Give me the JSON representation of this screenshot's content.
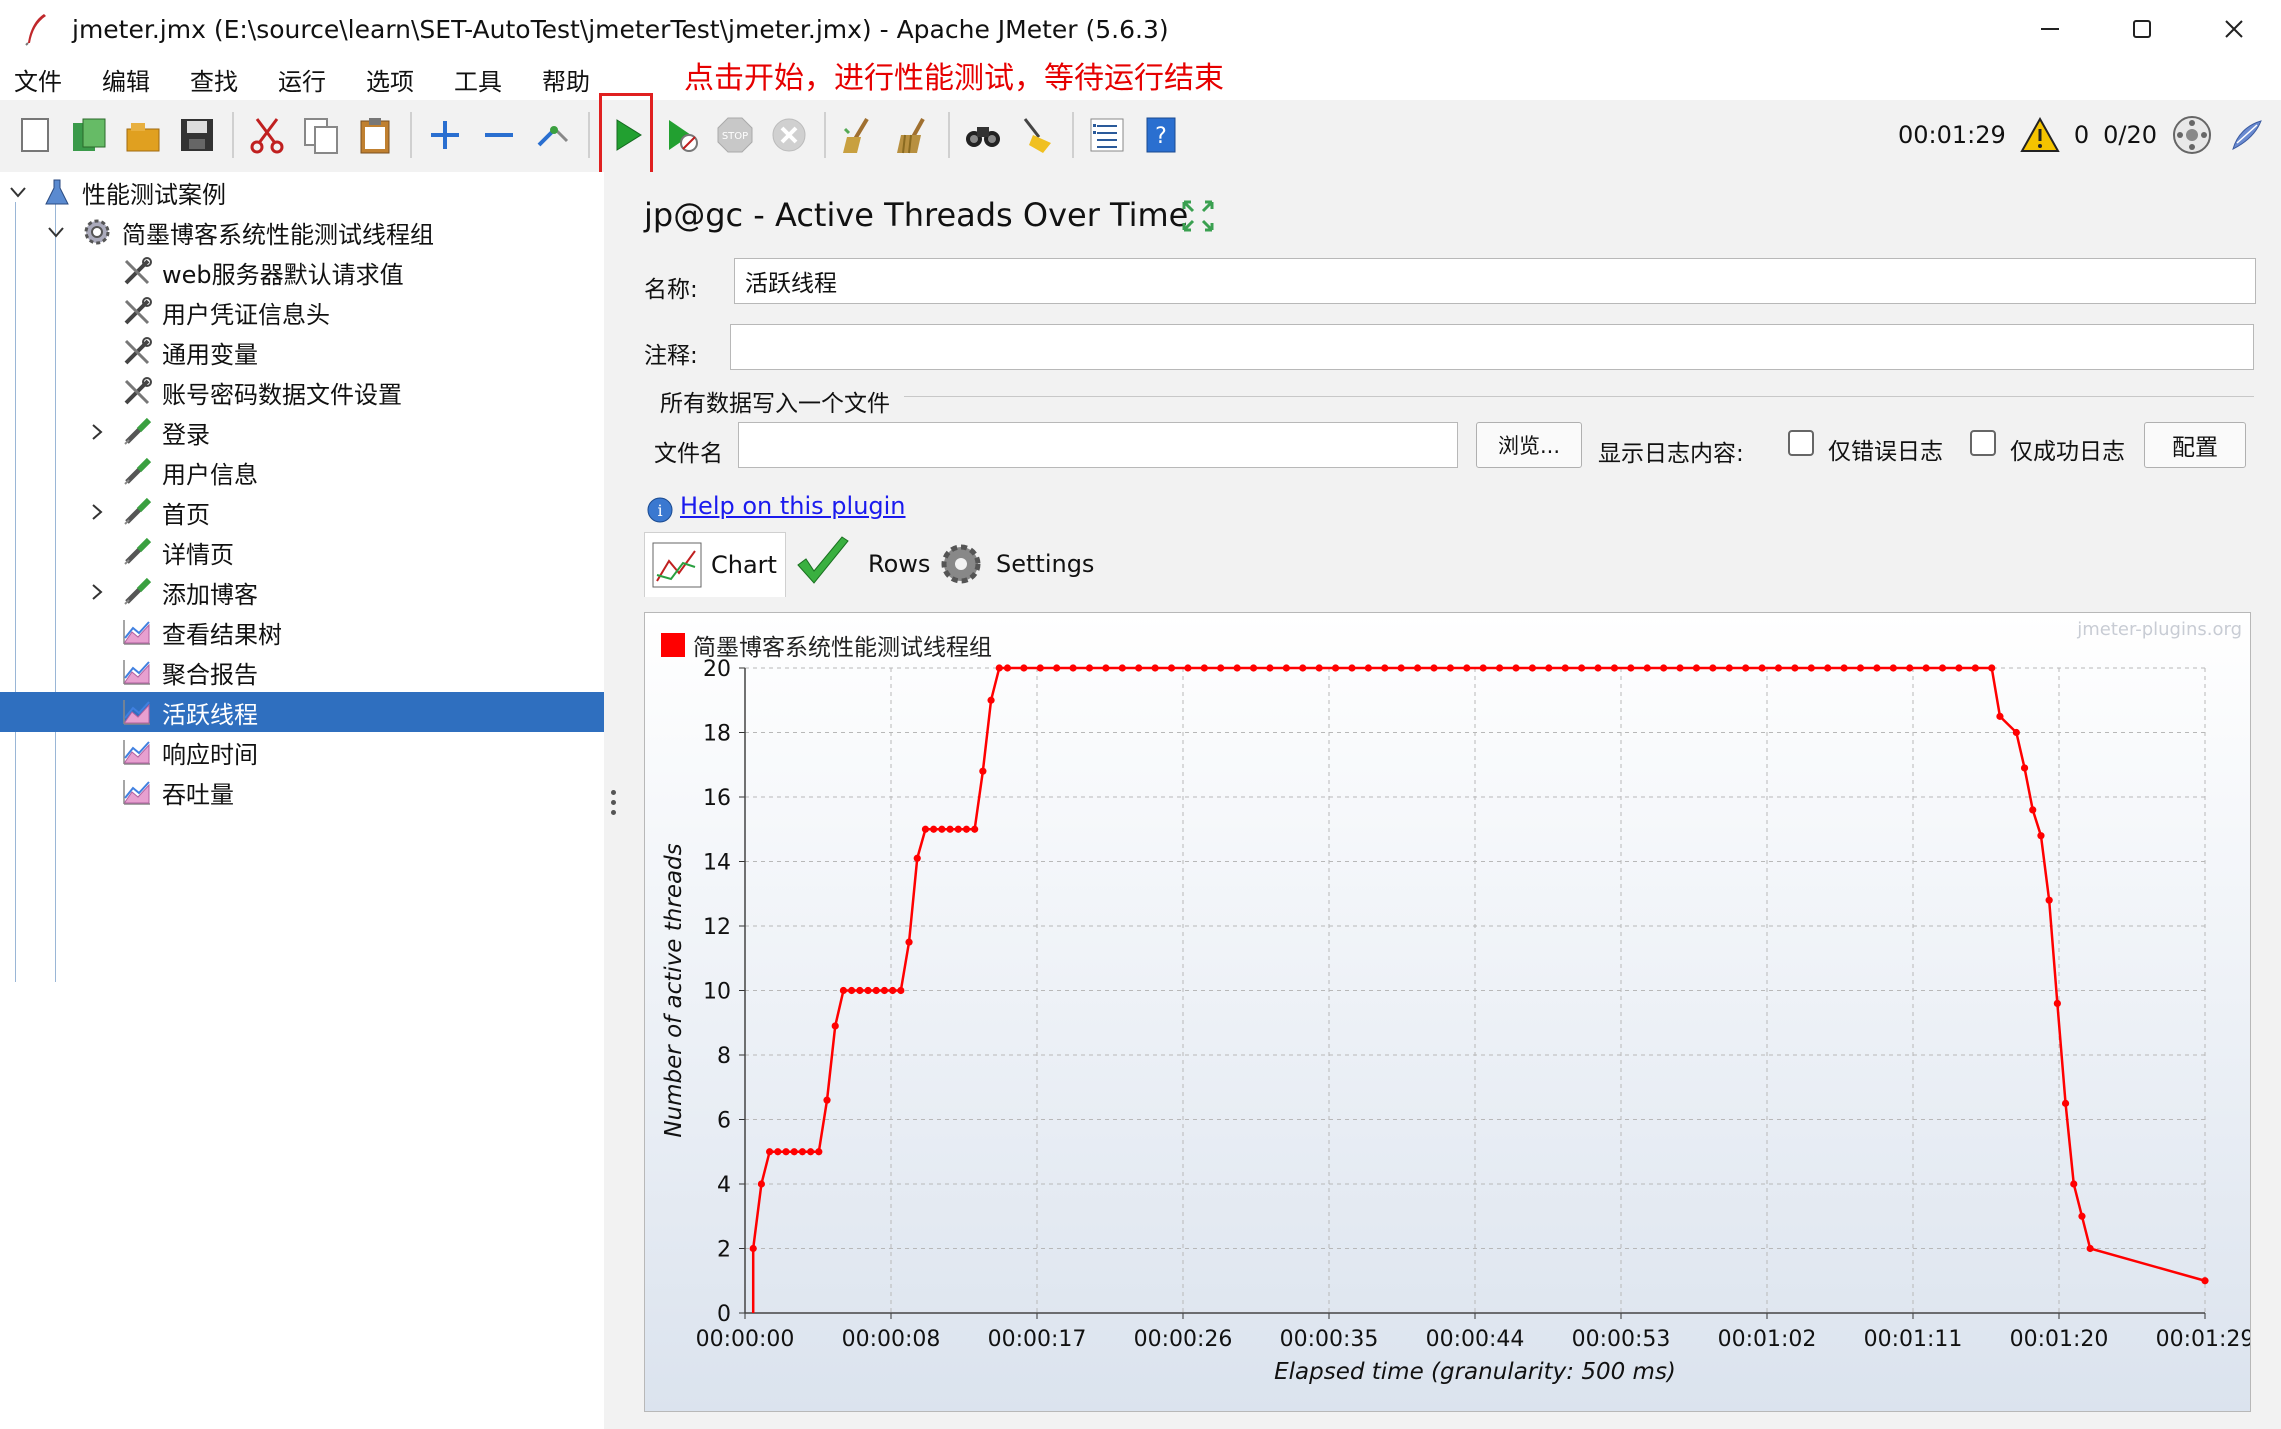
{
  "window": {
    "title": "jmeter.jmx (E:\\source\\learn\\SET-AutoTest\\jmeterTest\\jmeter.jmx) - Apache JMeter (5.6.3)",
    "minimize_icon": "minimize-icon",
    "maximize_icon": "maximize-icon",
    "close_icon": "close-icon"
  },
  "menu": [
    "文件",
    "编辑",
    "查找",
    "运行",
    "选项",
    "工具",
    "帮助"
  ],
  "annotation": "点击开始，进行性能测试，等待运行结束",
  "toolbar": {
    "elapsed": "00:01:29",
    "warnings": "0",
    "threads": "0/20",
    "icons": [
      "new-icon",
      "templates-icon",
      "open-icon",
      "save-icon",
      "cut-icon",
      "copy-icon",
      "paste-icon",
      "expand-icon",
      "collapse-icon",
      "toggle-icon",
      "start-icon",
      "start-no-pause-icon",
      "stop-icon",
      "shutdown-icon",
      "clear-icon",
      "clear-all-icon",
      "search-icon",
      "reset-search-icon",
      "function-helper-icon",
      "help-icon"
    ]
  },
  "tree": {
    "root": "性能测试案例",
    "thread_group": "简墨博客系统性能测试线程组",
    "items": [
      {
        "label": "web服务器默认请求值",
        "icon": "config-wrench-icon",
        "expandable": false
      },
      {
        "label": "用户凭证信息头",
        "icon": "config-wrench-icon",
        "expandable": false
      },
      {
        "label": "通用变量",
        "icon": "config-wrench-icon",
        "expandable": false
      },
      {
        "label": "账号密码数据文件设置",
        "icon": "config-wrench-icon",
        "expandable": false
      },
      {
        "label": "登录",
        "icon": "sampler-pipette-icon",
        "expandable": true
      },
      {
        "label": "用户信息",
        "icon": "sampler-pipette-icon",
        "expandable": false
      },
      {
        "label": "首页",
        "icon": "sampler-pipette-icon",
        "expandable": true
      },
      {
        "label": "详情页",
        "icon": "sampler-pipette-icon",
        "expandable": false
      },
      {
        "label": "添加博客",
        "icon": "sampler-pipette-icon",
        "expandable": true
      },
      {
        "label": "查看结果树",
        "icon": "listener-graph-icon",
        "expandable": false
      },
      {
        "label": "聚合报告",
        "icon": "listener-graph-icon",
        "expandable": false
      },
      {
        "label": "活跃线程",
        "icon": "listener-graph-icon",
        "expandable": false,
        "selected": true
      },
      {
        "label": "响应时间",
        "icon": "listener-graph-icon",
        "expandable": false
      },
      {
        "label": "吞吐量",
        "icon": "listener-graph-icon",
        "expandable": false
      }
    ]
  },
  "panel": {
    "title": "jp@gc - Active Threads Over Time",
    "name_label": "名称:",
    "name_value": "活跃线程",
    "comment_label": "注释:",
    "comment_value": "",
    "fieldset_label": "所有数据写入一个文件",
    "filename_label": "文件名",
    "filename_value": "",
    "browse_button": "浏览...",
    "log_display_label": "显示日志内容:",
    "errors_only_label": "仅错误日志",
    "success_only_label": "仅成功日志",
    "configure_button": "配置",
    "help_link": "Help on this plugin",
    "tabs": [
      "Chart",
      "Rows",
      "Settings"
    ],
    "watermark": "jmeter-plugins.org"
  },
  "chart_data": {
    "type": "line",
    "legend": "top-left",
    "series": [
      {
        "name": "简墨博客系统性能测试线程组",
        "color": "#ff0000",
        "points": [
          [
            0.5,
            2
          ],
          [
            1,
            4
          ],
          [
            1.5,
            5
          ],
          [
            2,
            5
          ],
          [
            2.5,
            5
          ],
          [
            3,
            5
          ],
          [
            3.5,
            5
          ],
          [
            4,
            5
          ],
          [
            4.5,
            5
          ],
          [
            5,
            6.6
          ],
          [
            5.5,
            8.9
          ],
          [
            6,
            10
          ],
          [
            6.5,
            10
          ],
          [
            7,
            10
          ],
          [
            7.5,
            10
          ],
          [
            8,
            10
          ],
          [
            8.5,
            10
          ],
          [
            9,
            10
          ],
          [
            9.5,
            10
          ],
          [
            10,
            11.5
          ],
          [
            10.5,
            14.1
          ],
          [
            11,
            15
          ],
          [
            11.5,
            15
          ],
          [
            12,
            15
          ],
          [
            12.5,
            15
          ],
          [
            13,
            15
          ],
          [
            13.5,
            15
          ],
          [
            14,
            15
          ],
          [
            14.5,
            16.8
          ],
          [
            15,
            19
          ],
          [
            15.5,
            20
          ],
          [
            16,
            20
          ],
          [
            17,
            20
          ],
          [
            18,
            20
          ],
          [
            19,
            20
          ],
          [
            20,
            20
          ],
          [
            21,
            20
          ],
          [
            22,
            20
          ],
          [
            23,
            20
          ],
          [
            24,
            20
          ],
          [
            25,
            20
          ],
          [
            26,
            20
          ],
          [
            27,
            20
          ],
          [
            28,
            20
          ],
          [
            29,
            20
          ],
          [
            30,
            20
          ],
          [
            31,
            20
          ],
          [
            32,
            20
          ],
          [
            33,
            20
          ],
          [
            34,
            20
          ],
          [
            35,
            20
          ],
          [
            36,
            20
          ],
          [
            37,
            20
          ],
          [
            38,
            20
          ],
          [
            39,
            20
          ],
          [
            40,
            20
          ],
          [
            41,
            20
          ],
          [
            42,
            20
          ],
          [
            43,
            20
          ],
          [
            44,
            20
          ],
          [
            45,
            20
          ],
          [
            46,
            20
          ],
          [
            47,
            20
          ],
          [
            48,
            20
          ],
          [
            49,
            20
          ],
          [
            50,
            20
          ],
          [
            51,
            20
          ],
          [
            52,
            20
          ],
          [
            53,
            20
          ],
          [
            54,
            20
          ],
          [
            55,
            20
          ],
          [
            56,
            20
          ],
          [
            57,
            20
          ],
          [
            58,
            20
          ],
          [
            59,
            20
          ],
          [
            60,
            20
          ],
          [
            61,
            20
          ],
          [
            62,
            20
          ],
          [
            63,
            20
          ],
          [
            64,
            20
          ],
          [
            65,
            20
          ],
          [
            66,
            20
          ],
          [
            67,
            20
          ],
          [
            68,
            20
          ],
          [
            69,
            20
          ],
          [
            70,
            20
          ],
          [
            71,
            20
          ],
          [
            72,
            20
          ],
          [
            73,
            20
          ],
          [
            74,
            20
          ],
          [
            75,
            20
          ],
          [
            76,
            20
          ],
          [
            76.5,
            18.5
          ],
          [
            77.5,
            18
          ],
          [
            78,
            16.9
          ],
          [
            78.5,
            15.6
          ],
          [
            79,
            14.8
          ],
          [
            79.5,
            12.8
          ],
          [
            80,
            9.6
          ],
          [
            80.5,
            6.5
          ],
          [
            81,
            4
          ],
          [
            81.5,
            3
          ],
          [
            82,
            2
          ],
          [
            89,
            1
          ]
        ]
      }
    ],
    "x_ticks": [
      "00:00:00",
      "00:00:08",
      "00:00:17",
      "00:00:26",
      "00:00:35",
      "00:00:44",
      "00:00:53",
      "00:01:02",
      "00:01:11",
      "00:01:20",
      "00:01:29"
    ],
    "xlim": [
      0,
      89
    ],
    "ylim": [
      0,
      20
    ],
    "y_ticks": [
      0,
      2,
      4,
      6,
      8,
      10,
      12,
      14,
      16,
      18,
      20
    ],
    "xlabel": "Elapsed time (granularity: 500 ms)",
    "ylabel": "Number of active threads",
    "grid": true
  }
}
